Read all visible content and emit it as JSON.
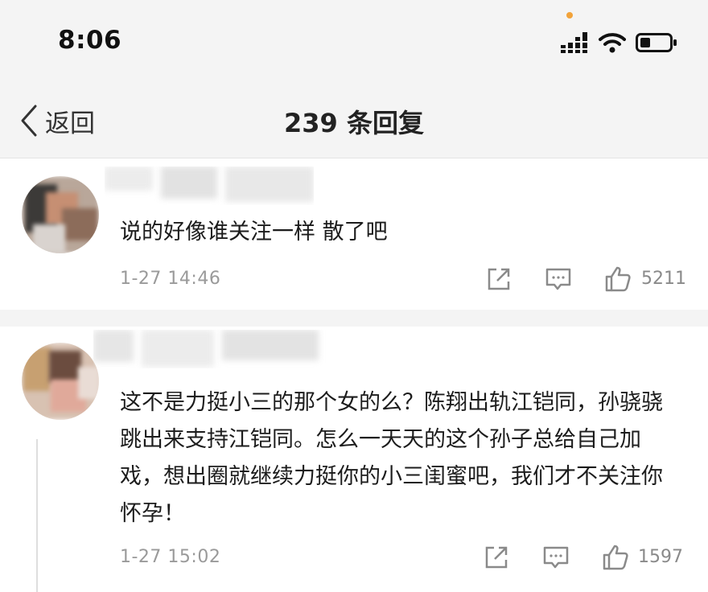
{
  "status": {
    "time": "8:06"
  },
  "nav": {
    "back_label": "返回",
    "title": "239 条回复"
  },
  "comments": [
    {
      "text": "说的好像谁关注一样 散了吧",
      "timestamp": "1-27 14:46",
      "likes": "5211"
    },
    {
      "text": "这不是力挺小三的那个女的么？陈翔出轨江铠同，孙骁骁跳出来支持江铠同。怎么一天天的这个孙子总给自己加戏，想出圈就继续力挺你的小三闺蜜吧，我们才不关注你怀孕！",
      "timestamp": "1-27 15:02",
      "likes": "1597"
    }
  ],
  "icons": {
    "share": "share-icon",
    "comment": "comment-icon",
    "like": "thumbs-up-icon",
    "back": "chevron-left-icon",
    "signal": "signal-icon",
    "wifi": "wifi-icon",
    "battery": "battery-icon"
  },
  "colors": {
    "background": "#f4f4f4",
    "card": "#ffffff",
    "meta_text": "#9a9a9a",
    "indicator_dot": "#f2a33a"
  }
}
